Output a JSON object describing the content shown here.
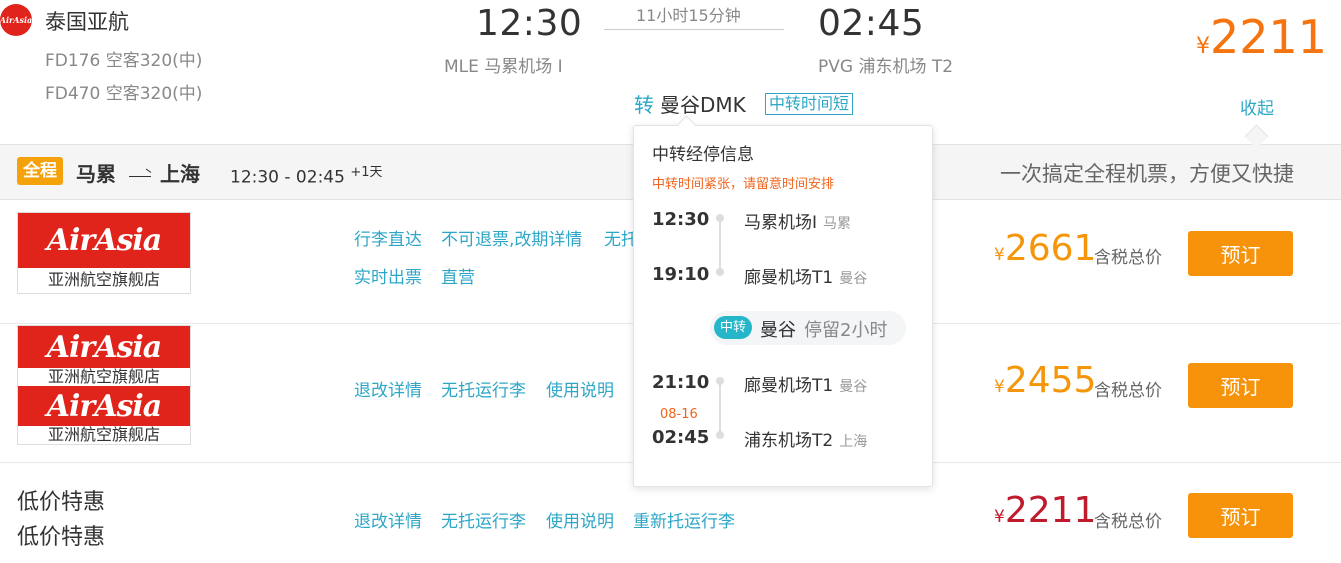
{
  "flight": {
    "logo_text": "AirAsia",
    "airline": "泰国亚航",
    "segments": [
      "FD176 空客320(中)",
      "FD470 空客320(中)"
    ],
    "dep_time": "12:30",
    "dep_airport": "MLE 马累机场 I",
    "duration": "11小时15分钟",
    "arr_time": "02:45",
    "arr_airport": "PVG 浦东机场 T2",
    "price_symbol": "¥",
    "price": "2211",
    "transfer_label": "转",
    "transfer_city": "曼谷DMK",
    "short_badge": "中转时间短",
    "collapse": "收起"
  },
  "summary": {
    "badge": "全程",
    "from": "马累",
    "to": "上海",
    "time": "12:30 - 02:45",
    "plus_day": "+1天",
    "slogan": "一次搞定全程机票，方便又快捷"
  },
  "rows": [
    {
      "logo_top": "AirAsia",
      "logo_bottom": "亚洲航空旗舰店",
      "links": [
        "行李直达",
        "不可退票,改期详情",
        "无托"
      ],
      "links2": [
        "实时出票",
        "直营"
      ],
      "price_symbol": "¥",
      "price": "2661",
      "tax": "含税总价",
      "button": "预订"
    },
    {
      "logo_top": "AirAsia",
      "logo_bottom": "亚洲航空旗舰店",
      "logo_top2": "AirAsia",
      "logo_bottom2": "亚洲航空旗舰店",
      "links": [
        "退改详情",
        "无托运行李",
        "使用说明"
      ],
      "price_symbol": "¥",
      "price": "2455",
      "tax": "含税总价",
      "button": "预订"
    },
    {
      "title1": "低价特惠",
      "title2": "低价特惠",
      "links": [
        "退改详情",
        "无托运行李",
        "使用说明",
        "重新托运行李"
      ],
      "price_symbol": "¥",
      "price": "2211",
      "tax": "含税总价",
      "button": "预订"
    }
  ],
  "popup": {
    "title": "中转经停信息",
    "warning": "中转时间紧张，请留意时间安排",
    "leg1": {
      "dep_time": "12:30",
      "dep_airport": "马累机场I",
      "dep_city": "马累",
      "arr_time": "19:10",
      "arr_airport": "廊曼机场T1",
      "arr_city": "曼谷"
    },
    "stop": {
      "badge": "中转",
      "city": "曼谷",
      "stay": "停留2小时"
    },
    "leg2": {
      "dep_time": "21:10",
      "dep_airport": "廊曼机场T1",
      "dep_city": "曼谷",
      "arr_date": "08-16",
      "arr_time": "02:45",
      "arr_airport": "浦东机场T2",
      "arr_city": "上海"
    }
  },
  "colors": {
    "accent": "#2ea7c7",
    "price_orange": "#f5740f",
    "button": "#f7920b",
    "price_red": "#c01b2c",
    "airasia_red": "#e0241b"
  }
}
